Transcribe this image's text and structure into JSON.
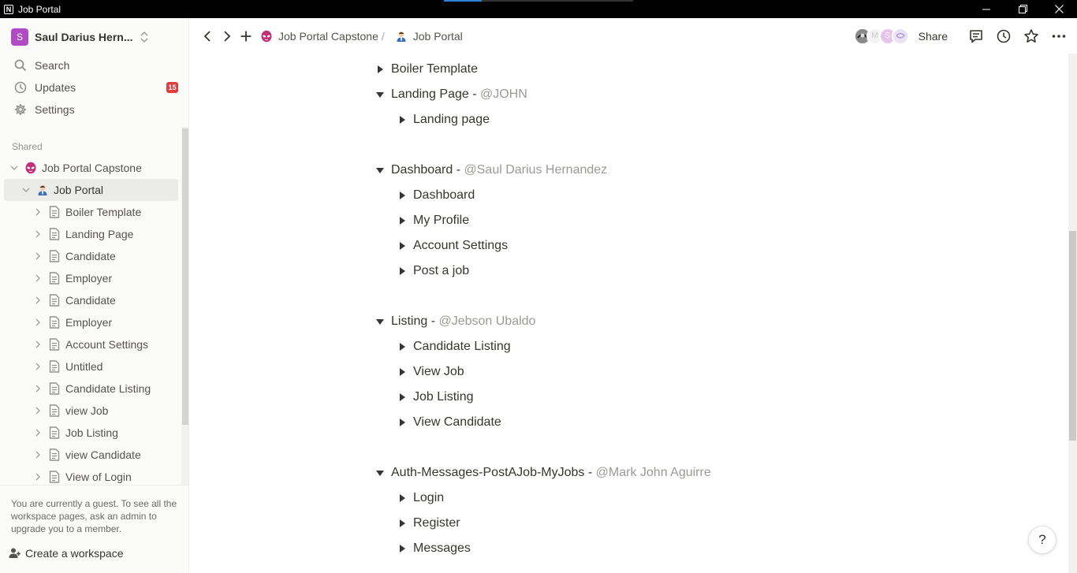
{
  "window": {
    "title": "Job Portal",
    "load_progress": 0.2
  },
  "sidebar": {
    "workspace": {
      "avatar_letter": "S",
      "name": "Saul Darius Hern..."
    },
    "nav": [
      {
        "label": "Search",
        "icon": "search-icon"
      },
      {
        "label": "Updates",
        "icon": "clock-icon",
        "badge": "15"
      },
      {
        "label": "Settings",
        "icon": "gear-icon"
      }
    ],
    "section_label": "Shared",
    "tree": {
      "root": {
        "label": "Job Portal Capstone",
        "icon": "alien-emoji-icon"
      },
      "page": {
        "label": "Job Portal",
        "icon": "person-emoji-icon"
      },
      "children": [
        "Boiler Template",
        "Landing Page",
        "Candidate",
        "Employer",
        "Candidate",
        "Employer",
        "Account Settings",
        "Untitled",
        "Candidate Listing",
        "view Job",
        "Job Listing",
        "view Candidate",
        "View of Login"
      ]
    },
    "guest_note": "You are currently a guest. To see all the workspace pages, ask an admin to upgrade you to a member.",
    "create_workspace": "Create a workspace"
  },
  "topbar": {
    "breadcrumbs": [
      {
        "label": "Job Portal Capstone",
        "icon": "alien-emoji-icon"
      },
      {
        "label": "Job Portal",
        "icon": "person-emoji-icon"
      }
    ],
    "breadcrumb_separator": "/",
    "avatars": [
      "avatar-photo",
      "M",
      "S",
      "avatar-sketch"
    ],
    "share_label": "Share",
    "tools": [
      "comment-icon",
      "history-icon",
      "star-icon",
      "more-icon"
    ]
  },
  "content": {
    "sections": [
      {
        "title": "Boiler Template",
        "mention": "",
        "expanded": false,
        "items": []
      },
      {
        "title": "Landing Page - ",
        "mention": "@JOHN",
        "expanded": true,
        "items": [
          "Landing page"
        ]
      },
      {
        "title": "Dashboard - ",
        "mention": "@Saul Darius Hernandez",
        "expanded": true,
        "items": [
          "Dashboard",
          "My Profile",
          "Account Settings",
          "Post a job"
        ]
      },
      {
        "title": "Listing - ",
        "mention": "@Jebson Ubaldo",
        "expanded": true,
        "items": [
          "Candidate Listing",
          "View Job",
          "Job Listing",
          "View Candidate"
        ]
      },
      {
        "title": "Auth-Messages-PostAJob-MyJobs - ",
        "mention": "@Mark John Aguirre",
        "expanded": true,
        "items": [
          "Login",
          "Register",
          "Messages"
        ]
      }
    ]
  },
  "help_label": "?",
  "colors": {
    "workspace_avatar": "#b04bc3",
    "badge": "#e03e3e",
    "text": "#37352f",
    "mention": "#9b9a97",
    "sidebar_bg": "#fbfbfa",
    "active_row": "#ebebea"
  }
}
